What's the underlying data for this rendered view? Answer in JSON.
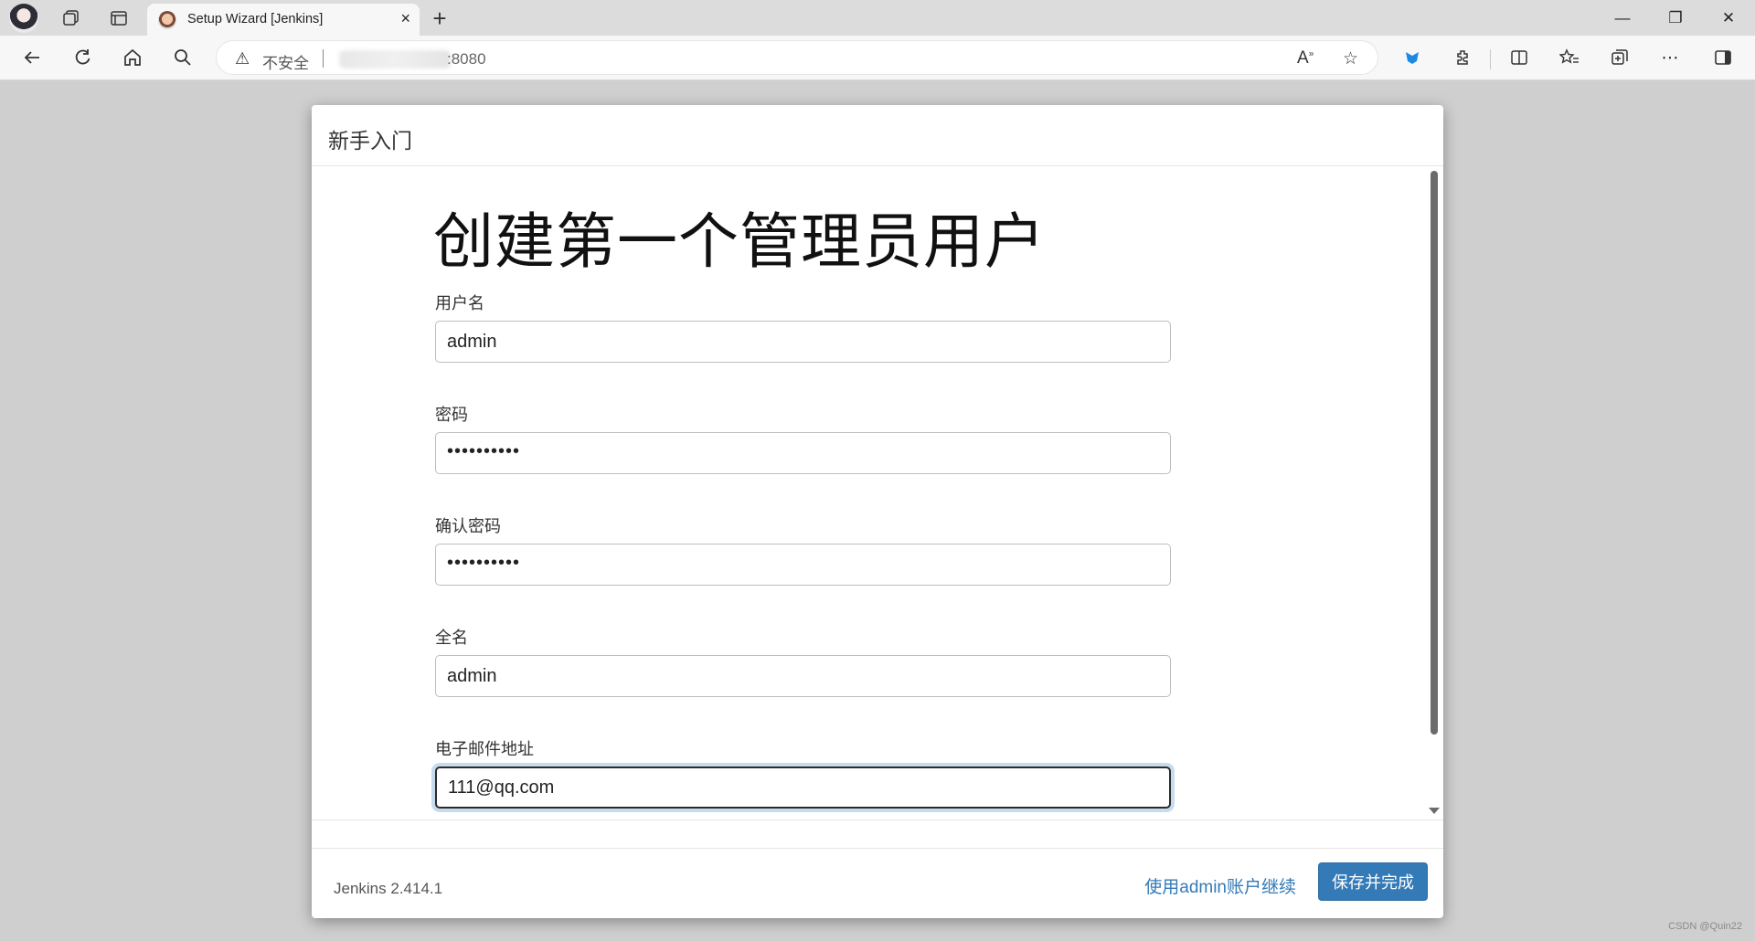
{
  "browser": {
    "tab_title": "Setup Wizard [Jenkins]",
    "tab_close": "×",
    "new_tab": "+",
    "security_label": "不安全",
    "url_suffix": ":8080",
    "minimize": "—",
    "restore": "❐",
    "close": "✕"
  },
  "dialog": {
    "header_title": "新手入门",
    "page_title": "创建第一个管理员用户",
    "fields": [
      {
        "label": "用户名",
        "value": "admin",
        "type": "text"
      },
      {
        "label": "密码",
        "value": "••••••••••",
        "type": "password"
      },
      {
        "label": "确认密码",
        "value": "••••••••••",
        "type": "password"
      },
      {
        "label": "全名",
        "value": "admin",
        "type": "text"
      },
      {
        "label": "电子邮件地址",
        "value": "111@qq.com",
        "type": "email"
      }
    ],
    "footer": {
      "version": "Jenkins 2.414.1",
      "continue_link": "使用admin账户继续",
      "save_button": "保存并完成"
    }
  },
  "watermark": "CSDN @Quin22"
}
